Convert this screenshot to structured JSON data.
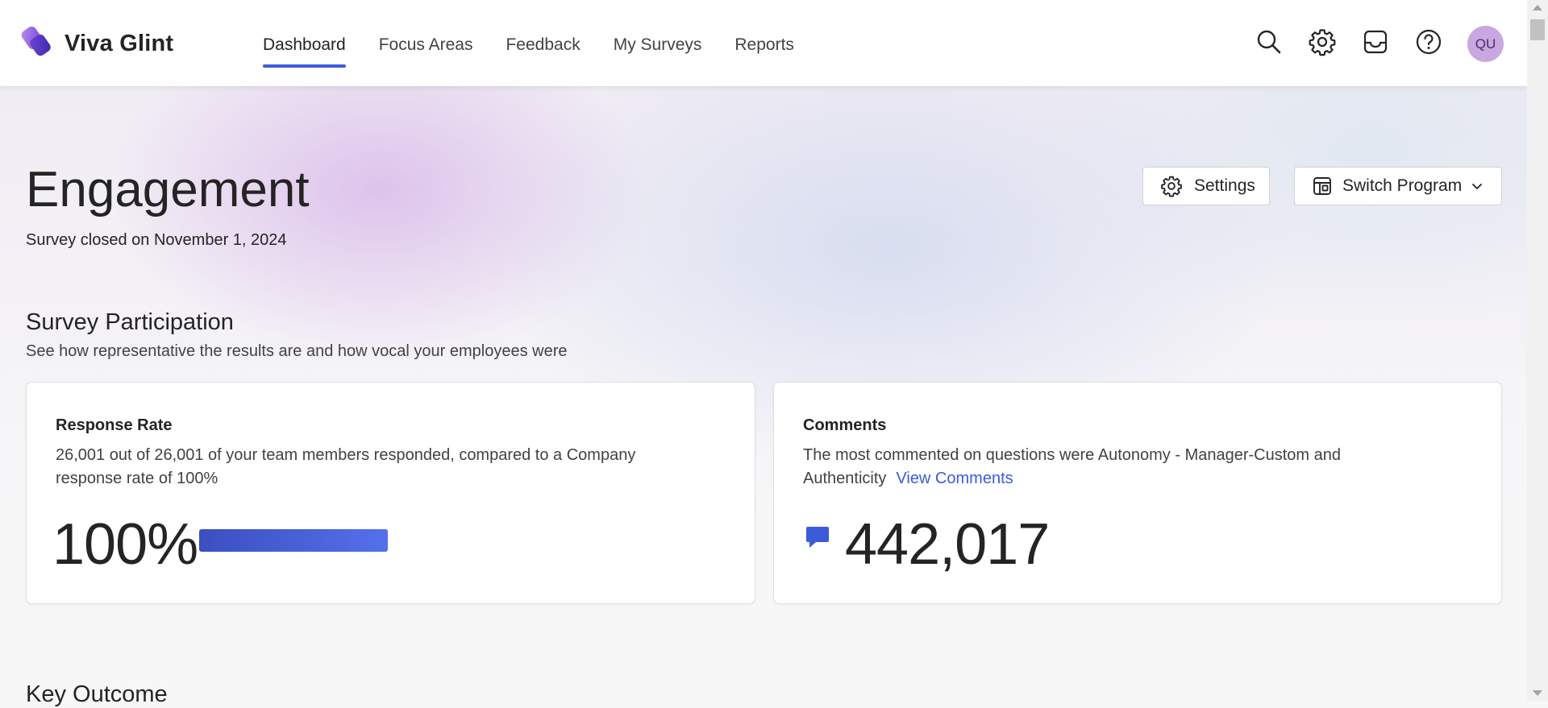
{
  "app": {
    "brand": "Viva Glint"
  },
  "nav": {
    "items": [
      {
        "label": "Dashboard",
        "active": true
      },
      {
        "label": "Focus Areas",
        "active": false
      },
      {
        "label": "Feedback",
        "active": false
      },
      {
        "label": "My Surveys",
        "active": false
      },
      {
        "label": "Reports",
        "active": false
      }
    ]
  },
  "header": {
    "icons": [
      "search-icon",
      "gear-icon",
      "inbox-icon",
      "help-icon"
    ],
    "avatar_initials": "QU"
  },
  "page": {
    "title": "Engagement",
    "subtitle": "Survey closed on November 1, 2024",
    "settings_label": "Settings",
    "switch_program_label": "Switch Program"
  },
  "participation": {
    "title": "Survey Participation",
    "subtitle": "See how representative the results are and how vocal your employees were",
    "response_rate": {
      "title": "Response Rate",
      "desc_line1": "26,001 out of 26,001 of your team members responded, compared to a Company",
      "desc_line2": "response rate of 100%",
      "value": "100%",
      "progress_fraction": 1.0
    },
    "comments": {
      "title": "Comments",
      "desc_line1": "The most commented on questions were Autonomy - Manager-Custom and",
      "desc_line2": "Authenticity",
      "link": "View Comments",
      "value": "442,017"
    }
  },
  "next_section": {
    "title": "Key Outcome"
  },
  "colors": {
    "accent": "#3b5bdb",
    "avatar_bg": "#c9a7e0",
    "comment_icon": "#3b5bdb"
  }
}
